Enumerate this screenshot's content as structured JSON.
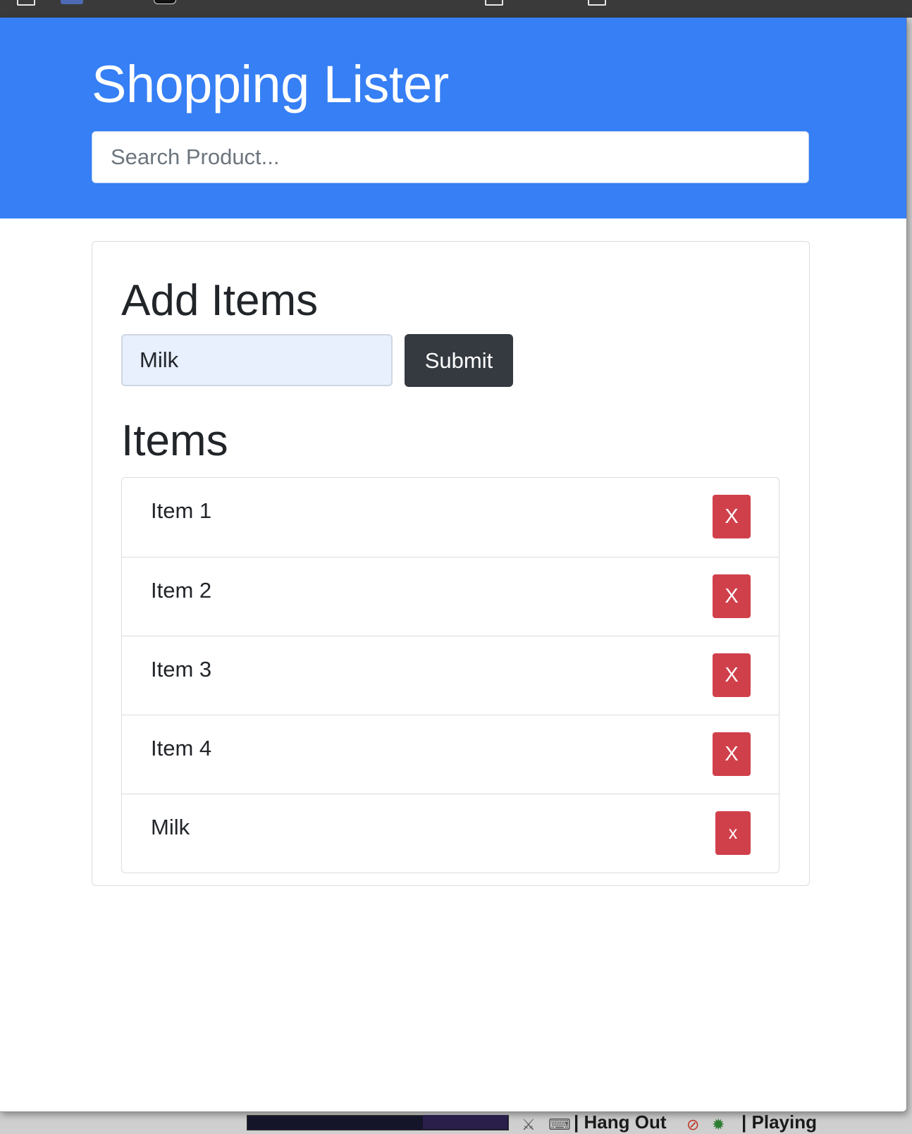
{
  "app": {
    "title": "Shopping Lister"
  },
  "search": {
    "placeholder": "Search Product..."
  },
  "add_section": {
    "heading": "Add Items",
    "input_value": "Milk",
    "submit_label": "Submit"
  },
  "items_section": {
    "heading": "Items",
    "items": [
      {
        "label": "Item 1",
        "delete_label": "X"
      },
      {
        "label": "Item 2",
        "delete_label": "X"
      },
      {
        "label": "Item 3",
        "delete_label": "X"
      },
      {
        "label": "Item 4",
        "delete_label": "X"
      },
      {
        "label": "Milk",
        "delete_label": "x"
      }
    ]
  },
  "dock": {
    "text_1": "| Hang Out",
    "text_2": "| Playing"
  },
  "colors": {
    "header": "#367ff5",
    "submit": "#343a40",
    "delete": "#d0404b"
  }
}
